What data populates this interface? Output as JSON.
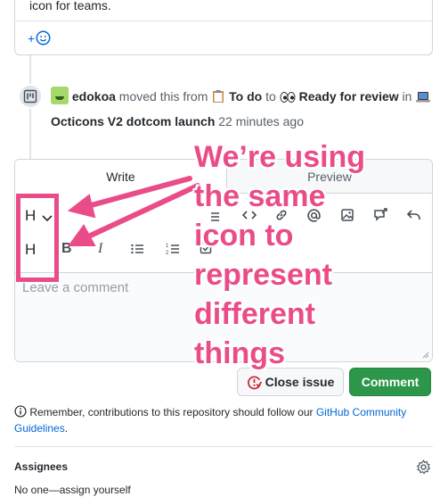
{
  "previous_comment": {
    "tail_text": "icon for teams.",
    "reaction_label": "+"
  },
  "timeline_event": {
    "actor": "edokoa",
    "action": "moved this from",
    "from_column": "To do",
    "to_word": "to",
    "to_column": "Ready for review",
    "in_word": "in",
    "project": "Octicons V2 dotcom launch",
    "time": "22 minutes ago"
  },
  "editor": {
    "tab_write": "Write",
    "tab_preview": "Preview",
    "placeholder": "Leave a comment",
    "toolbar_heading_label": "H",
    "toolbar_bold_label": "B",
    "toolbar_italic_label": "I"
  },
  "actions": {
    "close_issue": "Close issue",
    "comment": "Comment"
  },
  "guidelines": {
    "prefix": "Remember, contributions to this repository should follow our ",
    "link": "GitHub Community Guidelines",
    "suffix": "."
  },
  "sidebar": {
    "assignees_title": "Assignees",
    "assignees_empty": "No one—assign yourself"
  },
  "annotation": {
    "box_heading_1": "H",
    "box_heading_2": "H",
    "line1": "We’re using",
    "line2": "the same",
    "line3": "icon to",
    "line4": "represent",
    "line5": "different",
    "line6": "things",
    "color": "#ea4c89"
  },
  "colors": {
    "link": "#0366d6",
    "comment_button": "#2c974b",
    "close_issue_icon": "#cb2431"
  }
}
